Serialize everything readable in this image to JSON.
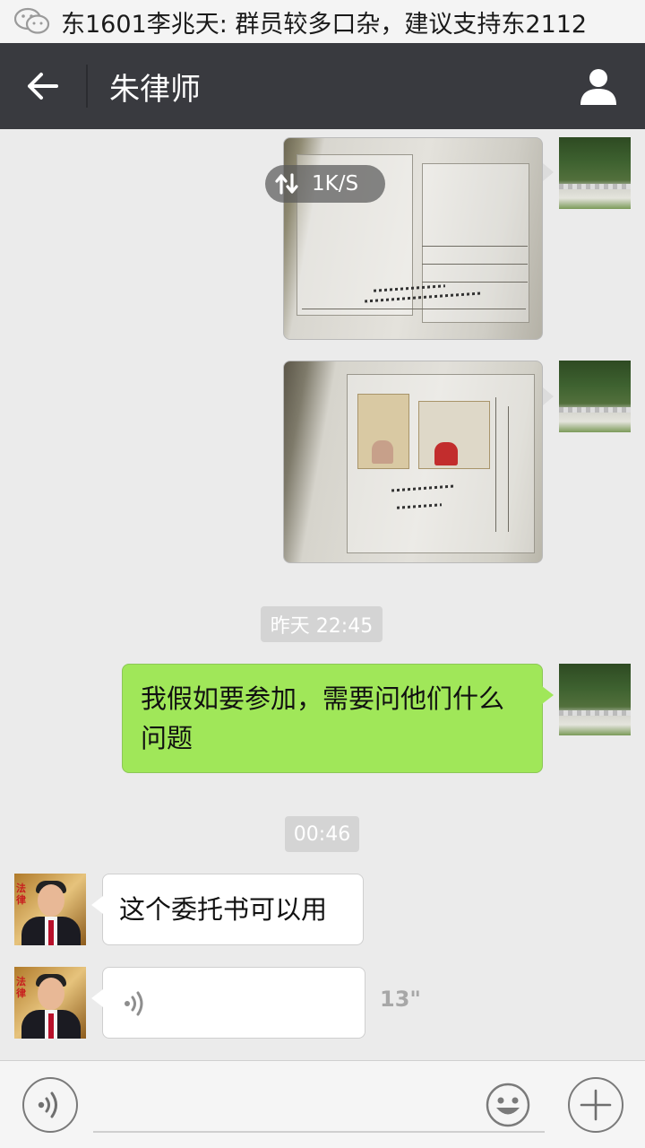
{
  "status_bar": {
    "notification_text": "东1601李兆天: 群员较多口杂，建议支持东2112",
    "app_icon": "wechat-icon"
  },
  "title_bar": {
    "title": "朱律师",
    "back_icon": "arrow-left-icon",
    "profile_icon": "person-icon"
  },
  "transfer": {
    "speed": "1K/S"
  },
  "messages": [
    {
      "type": "image",
      "sender": "self",
      "description": "photo of a document form"
    },
    {
      "type": "image",
      "sender": "self",
      "description": "photo of ID card copies"
    },
    {
      "type": "timestamp",
      "text": "昨天 22:45"
    },
    {
      "type": "text",
      "sender": "self",
      "text": "我假如要参加，需要问他们什么问题"
    },
    {
      "type": "timestamp",
      "text": "00:46"
    },
    {
      "type": "text",
      "sender": "other",
      "text": "这个委托书可以用"
    },
    {
      "type": "voice",
      "sender": "other",
      "duration": "13\""
    }
  ],
  "lawyer_avatar_text": "法律",
  "input_bar": {
    "voice_icon": "voice-icon",
    "emoji_icon": "smiley-icon",
    "plus_icon": "plus-icon",
    "placeholder": ""
  },
  "colors": {
    "title_bar_bg": "#393a3f",
    "chat_bg": "#ebebeb",
    "self_bubble": "#a0e759",
    "other_bubble": "#ffffff"
  }
}
